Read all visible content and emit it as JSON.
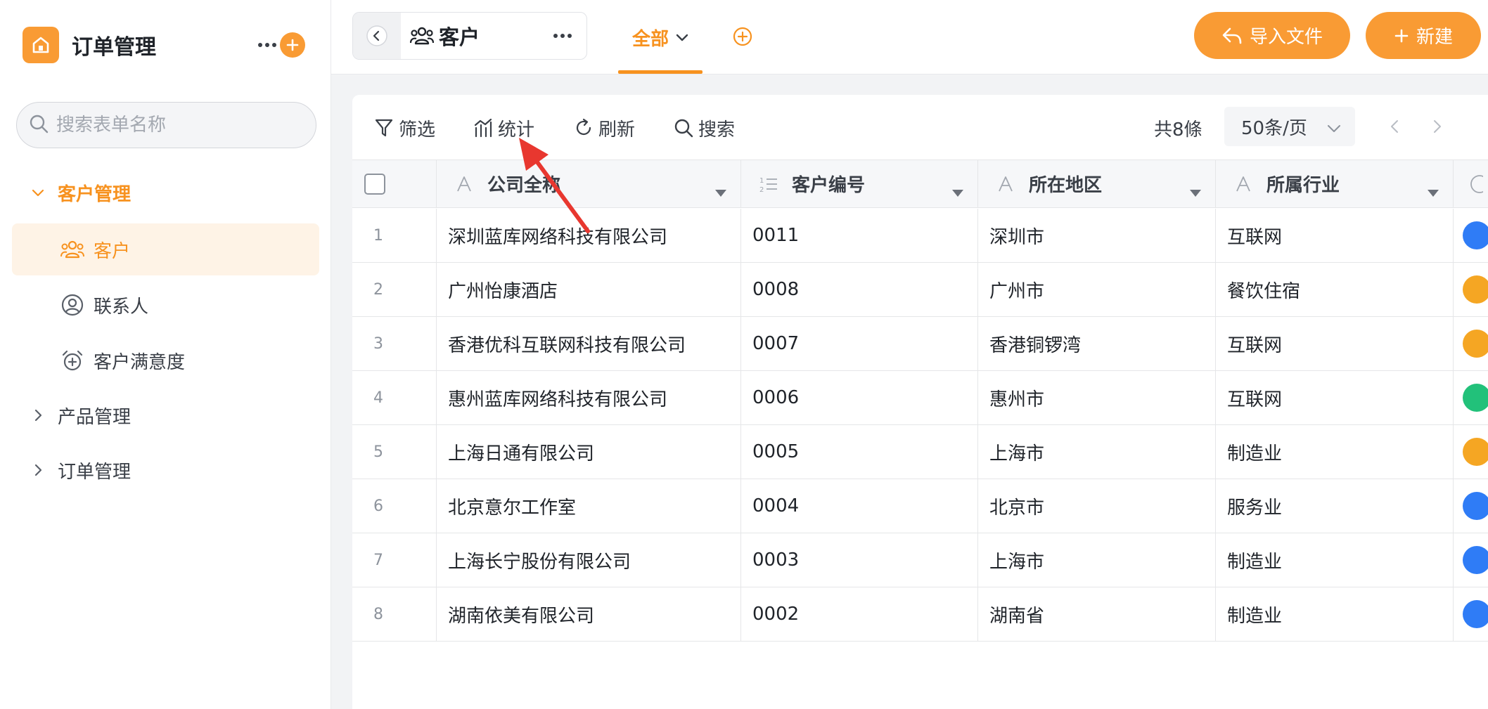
{
  "app": {
    "title": "订单管理",
    "logo_icon": "home-icon",
    "accent": "#f99b34"
  },
  "sidebar": {
    "search_placeholder": "搜索表单名称",
    "groups": [
      {
        "label": "客户管理",
        "expanded": true,
        "items": [
          {
            "label": "客户",
            "icon": "users-icon",
            "selected": true
          },
          {
            "label": "联系人",
            "icon": "user-circle-icon",
            "selected": false
          },
          {
            "label": "客户满意度",
            "icon": "alarm-clock-icon",
            "selected": false
          }
        ]
      },
      {
        "label": "产品管理",
        "expanded": false
      },
      {
        "label": "订单管理",
        "expanded": false
      }
    ]
  },
  "header": {
    "view_title": "客户",
    "tab_label": "全部",
    "import_label": "导入文件",
    "new_label": "新建"
  },
  "toolbar": {
    "filter_label": "筛选",
    "stats_label": "统计",
    "refresh_label": "刷新",
    "search_label": "搜索",
    "total_label": "共8條",
    "page_size_label": "50条/页"
  },
  "table": {
    "columns": [
      {
        "label": "公司全称",
        "type_icon": "text-type-icon"
      },
      {
        "label": "客户编号",
        "type_icon": "number-type-icon"
      },
      {
        "label": "所在地区",
        "type_icon": "text-type-icon"
      },
      {
        "label": "所属行业",
        "type_icon": "text-type-icon"
      }
    ],
    "rows": [
      {
        "index": "1",
        "company": "深圳蓝库网络科技有限公司",
        "code": "0011",
        "region": "深圳市",
        "industry": "互联网",
        "badge_color": "#2f7cf6"
      },
      {
        "index": "2",
        "company": "广州怡康酒店",
        "code": "0008",
        "region": "广州市",
        "industry": "餐饮住宿",
        "badge_color": "#f5a623"
      },
      {
        "index": "3",
        "company": "香港优科互联网科技有限公司",
        "code": "0007",
        "region": "香港铜锣湾",
        "industry": "互联网",
        "badge_color": "#f5a623"
      },
      {
        "index": "4",
        "company": "惠州蓝库网络科技有限公司",
        "code": "0006",
        "region": "惠州市",
        "industry": "互联网",
        "badge_color": "#22c17a"
      },
      {
        "index": "5",
        "company": "上海日通有限公司",
        "code": "0005",
        "region": "上海市",
        "industry": "制造业",
        "badge_color": "#f5a623"
      },
      {
        "index": "6",
        "company": "北京意尔工作室",
        "code": "0004",
        "region": "北京市",
        "industry": "服务业",
        "badge_color": "#2f7cf6"
      },
      {
        "index": "7",
        "company": "上海长宁股份有限公司",
        "code": "0003",
        "region": "上海市",
        "industry": "制造业",
        "badge_color": "#2f7cf6"
      },
      {
        "index": "8",
        "company": "湖南依美有限公司",
        "code": "0002",
        "region": "湖南省",
        "industry": "制造业",
        "badge_color": "#2f7cf6"
      }
    ]
  },
  "annotation": {
    "arrow_color": "#e8372f",
    "points_to": "stats-button"
  }
}
